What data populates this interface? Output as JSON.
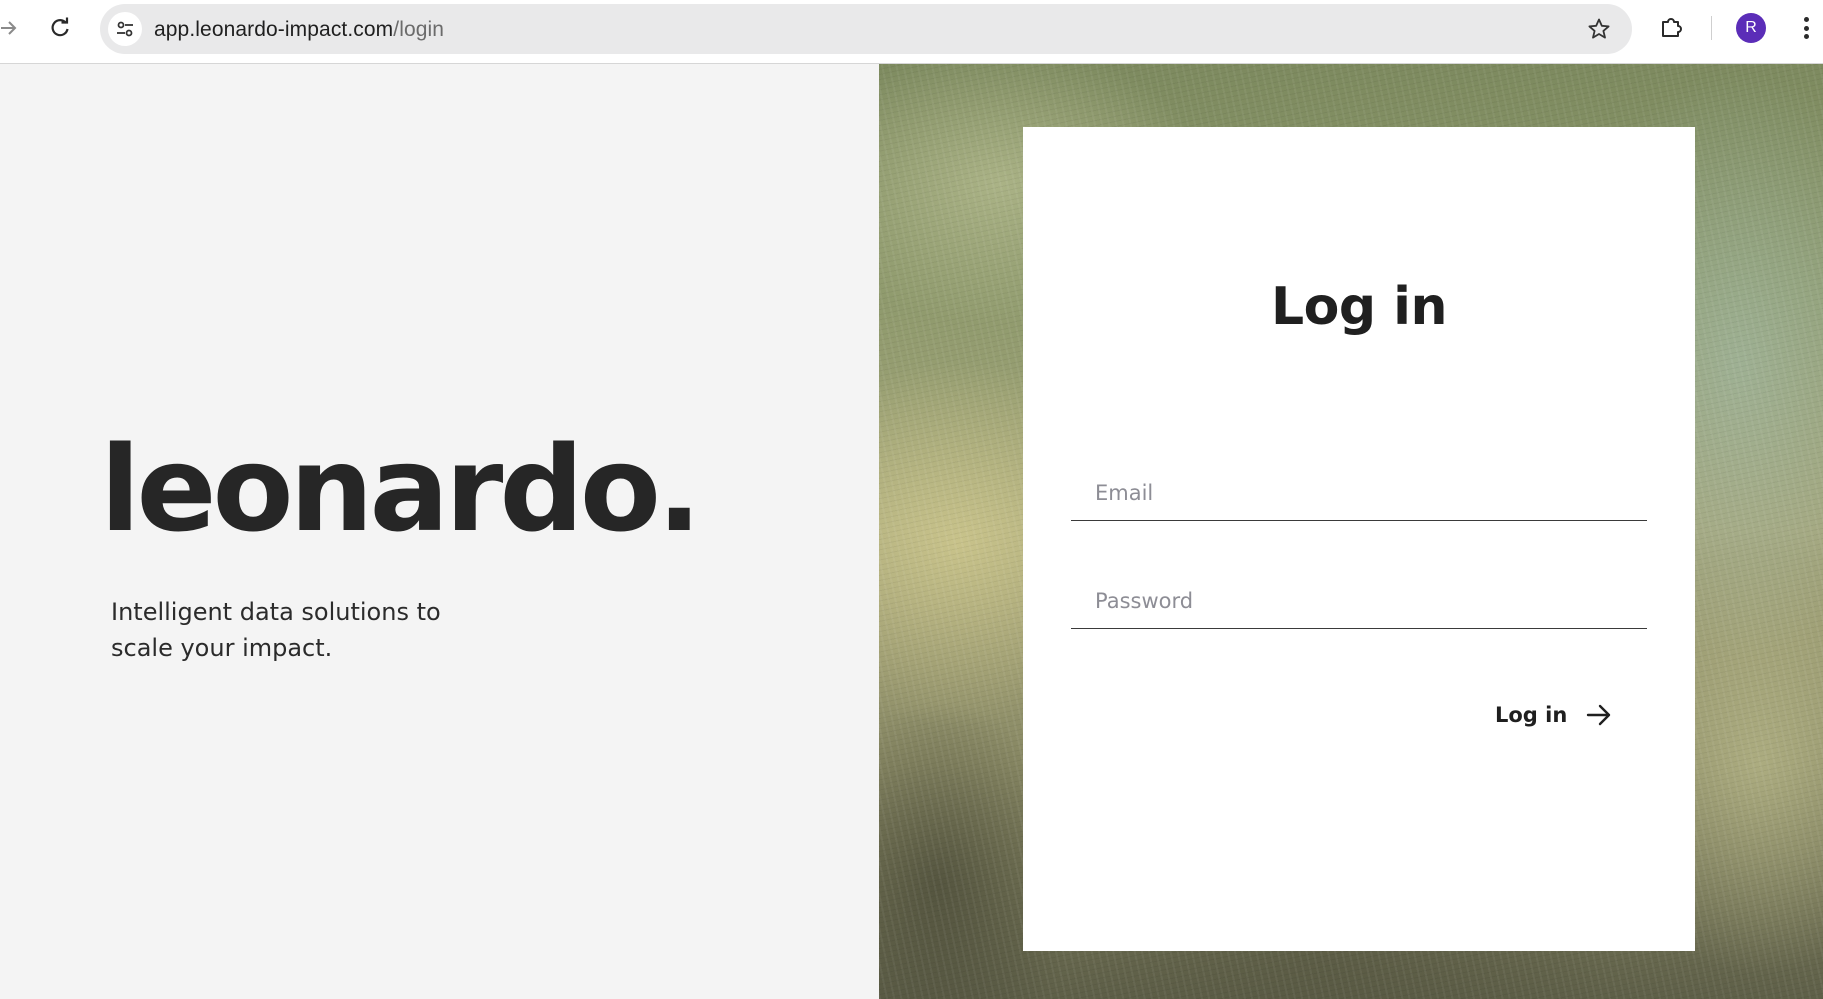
{
  "browser": {
    "url_host": "app.leonardo-impact.com",
    "url_path": "/login",
    "profile_initial": "R",
    "avatar_color": "#5b2db8"
  },
  "hero": {
    "brand": "leonardo.",
    "tagline_line1": "Intelligent data solutions to",
    "tagline_line2": "scale your impact."
  },
  "login_card": {
    "title": "Log in",
    "email_placeholder": "Email",
    "password_placeholder": "Password",
    "submit_label": "Log in",
    "submit_icon": "arrow-right-icon"
  },
  "colors": {
    "left_panel_bg": "#f4f4f4",
    "text_dark": "#262626",
    "card_bg": "#ffffff"
  }
}
